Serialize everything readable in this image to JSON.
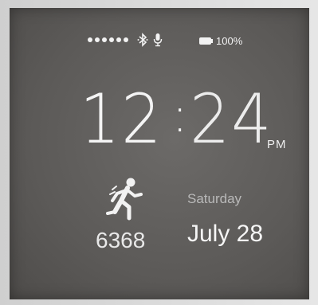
{
  "status_bar": {
    "signal_icon": "signal-dots-icon",
    "bluetooth_icon": "bluetooth-icon",
    "mic_icon": "microphone-icon",
    "battery_icon": "battery-icon",
    "battery_text": "100%",
    "battery_level": 1.0
  },
  "clock": {
    "hours": "12",
    "separator": ":",
    "minutes": "24",
    "ampm": "PM"
  },
  "activity": {
    "icon": "running-person-icon",
    "steps": "6368"
  },
  "calendar": {
    "day": "Saturday",
    "date": "July 28"
  },
  "colors": {
    "screen_bg": "#5e5c5a",
    "text_primary": "#f4f4f4",
    "text_secondary": "#b9b9b9"
  }
}
